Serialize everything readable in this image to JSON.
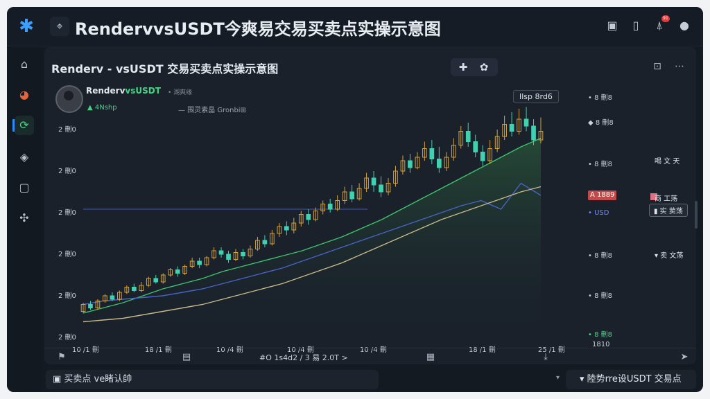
{
  "app": {
    "title": "RendervvsUSDT今爽易交易买卖点实操示意图",
    "icons": [
      "star-logo-icon",
      "pin-icon",
      "chat-icon",
      "tablet-icon",
      "bell-icon",
      "user-icon"
    ],
    "notification_count": "91"
  },
  "sidebar": {
    "items": [
      {
        "name": "home",
        "icon": "home-icon"
      },
      {
        "name": "portfolio",
        "icon": "pie-icon"
      },
      {
        "name": "trade",
        "icon": "refresh-icon",
        "active": true
      },
      {
        "name": "discover",
        "icon": "compass-icon"
      },
      {
        "name": "wallet",
        "icon": "wallet-icon"
      },
      {
        "name": "settings",
        "icon": "puzzle-icon"
      }
    ]
  },
  "panel": {
    "title": "Renderv - vsUSDT 交易买卖点实操示意图",
    "pair_base": "Renderv",
    "pair_quote": "vsUSDT",
    "pair_sub": "• 湖爽缘",
    "delta": "▲ 4Nshp",
    "legend": "— 围灵素晶 Gronbi⊞",
    "tooltip": "Ilsp 8rd6",
    "last_price": "A 1889",
    "bottom_right_label": "1810",
    "footer_text": "#O 1s4d2 / 3 易 2.0T >"
  },
  "annotations": {
    "a1": "喝 文 天",
    "a2": "商 工荡",
    "a3": "▮ 实 荬荡",
    "a4": "▾ 卖 文荡"
  },
  "bottombar": {
    "left": "▣  买卖点  ve睹认帥",
    "right": "▾ 陸势rre设USDT 交易点"
  },
  "chart_data": {
    "type": "candlestick",
    "y_ticks_left": [
      "2 刪0",
      "2 刪0",
      "2 刪0",
      "2 刪0",
      "2 刪0",
      "2 刪0"
    ],
    "y_ticks_right": [
      "• 8 刪8",
      "◆ 8 刪8",
      "• 8 刪8",
      "• 8 刪8",
      "• USD",
      "• 8 刪8",
      "• 8 刪8",
      "• 8 刪8"
    ],
    "x_ticks": [
      "10 /1 刪",
      "18 /1 刪",
      "10 /4 刪",
      "10 /4 刪",
      "10 /4 刪",
      "18 /1 刪",
      "25 /1 刪"
    ],
    "candles": [
      [
        22,
        30,
        20,
        32
      ],
      [
        30,
        26,
        24,
        34
      ],
      [
        26,
        34,
        24,
        36
      ],
      [
        34,
        40,
        32,
        42
      ],
      [
        40,
        36,
        34,
        44
      ],
      [
        36,
        44,
        34,
        46
      ],
      [
        44,
        50,
        42,
        52
      ],
      [
        50,
        46,
        44,
        54
      ],
      [
        46,
        52,
        44,
        56
      ],
      [
        52,
        60,
        50,
        62
      ],
      [
        60,
        56,
        54,
        64
      ],
      [
        56,
        64,
        54,
        66
      ],
      [
        64,
        70,
        62,
        72
      ],
      [
        70,
        66,
        62,
        74
      ],
      [
        66,
        74,
        64,
        76
      ],
      [
        74,
        80,
        72,
        84
      ],
      [
        80,
        76,
        72,
        84
      ],
      [
        76,
        84,
        74,
        86
      ],
      [
        84,
        92,
        82,
        96
      ],
      [
        92,
        88,
        84,
        96
      ],
      [
        88,
        82,
        78,
        92
      ],
      [
        82,
        90,
        80,
        94
      ],
      [
        90,
        86,
        82,
        94
      ],
      [
        86,
        94,
        84,
        98
      ],
      [
        94,
        104,
        92,
        108
      ],
      [
        104,
        100,
        96,
        110
      ],
      [
        100,
        112,
        98,
        116
      ],
      [
        112,
        120,
        108,
        124
      ],
      [
        120,
        116,
        110,
        126
      ],
      [
        116,
        124,
        112,
        130
      ],
      [
        124,
        134,
        120,
        138
      ],
      [
        134,
        128,
        122,
        140
      ],
      [
        128,
        138,
        126,
        142
      ],
      [
        138,
        146,
        134,
        150
      ],
      [
        146,
        140,
        136,
        152
      ],
      [
        140,
        150,
        138,
        156
      ],
      [
        150,
        160,
        146,
        166
      ],
      [
        160,
        152,
        148,
        168
      ],
      [
        152,
        164,
        150,
        170
      ],
      [
        164,
        176,
        160,
        182
      ],
      [
        176,
        168,
        160,
        184
      ],
      [
        168,
        160,
        154,
        178
      ],
      [
        160,
        170,
        156,
        176
      ],
      [
        170,
        184,
        166,
        190
      ],
      [
        184,
        196,
        180,
        202
      ],
      [
        196,
        188,
        182,
        204
      ],
      [
        188,
        200,
        186,
        206
      ],
      [
        200,
        210,
        196,
        218
      ],
      [
        210,
        198,
        192,
        220
      ],
      [
        198,
        188,
        182,
        212
      ],
      [
        188,
        200,
        184,
        206
      ],
      [
        200,
        214,
        196,
        222
      ],
      [
        214,
        230,
        210,
        236
      ],
      [
        230,
        218,
        212,
        240
      ],
      [
        218,
        206,
        200,
        226
      ],
      [
        206,
        196,
        190,
        214
      ],
      [
        196,
        210,
        192,
        220
      ],
      [
        210,
        224,
        206,
        232
      ],
      [
        224,
        238,
        220,
        248
      ],
      [
        238,
        230,
        224,
        252
      ],
      [
        230,
        244,
        226,
        256
      ],
      [
        244,
        236,
        230,
        258
      ],
      [
        236,
        220,
        214,
        244
      ],
      [
        220,
        230,
        216,
        246
      ]
    ],
    "series": [
      {
        "name": "green",
        "values": [
          20,
          26,
          32,
          40,
          48,
          54,
          60,
          68,
          74,
          80,
          86,
          92,
          100,
          108,
          118,
          128,
          140,
          152,
          164,
          176,
          188,
          200,
          212,
          222
        ]
      },
      {
        "name": "blue",
        "values": [
          30,
          34,
          36,
          38,
          40,
          44,
          48,
          54,
          60,
          66,
          72,
          80,
          88,
          96,
          104,
          112,
          120,
          128,
          136,
          144,
          150,
          140,
          170,
          156
        ]
      },
      {
        "name": "beige",
        "values": [
          10,
          12,
          14,
          18,
          22,
          26,
          30,
          36,
          42,
          48,
          54,
          62,
          70,
          78,
          88,
          98,
          108,
          118,
          128,
          136,
          144,
          152,
          160,
          166
        ]
      }
    ],
    "ylim": [
      0,
      260
    ]
  }
}
